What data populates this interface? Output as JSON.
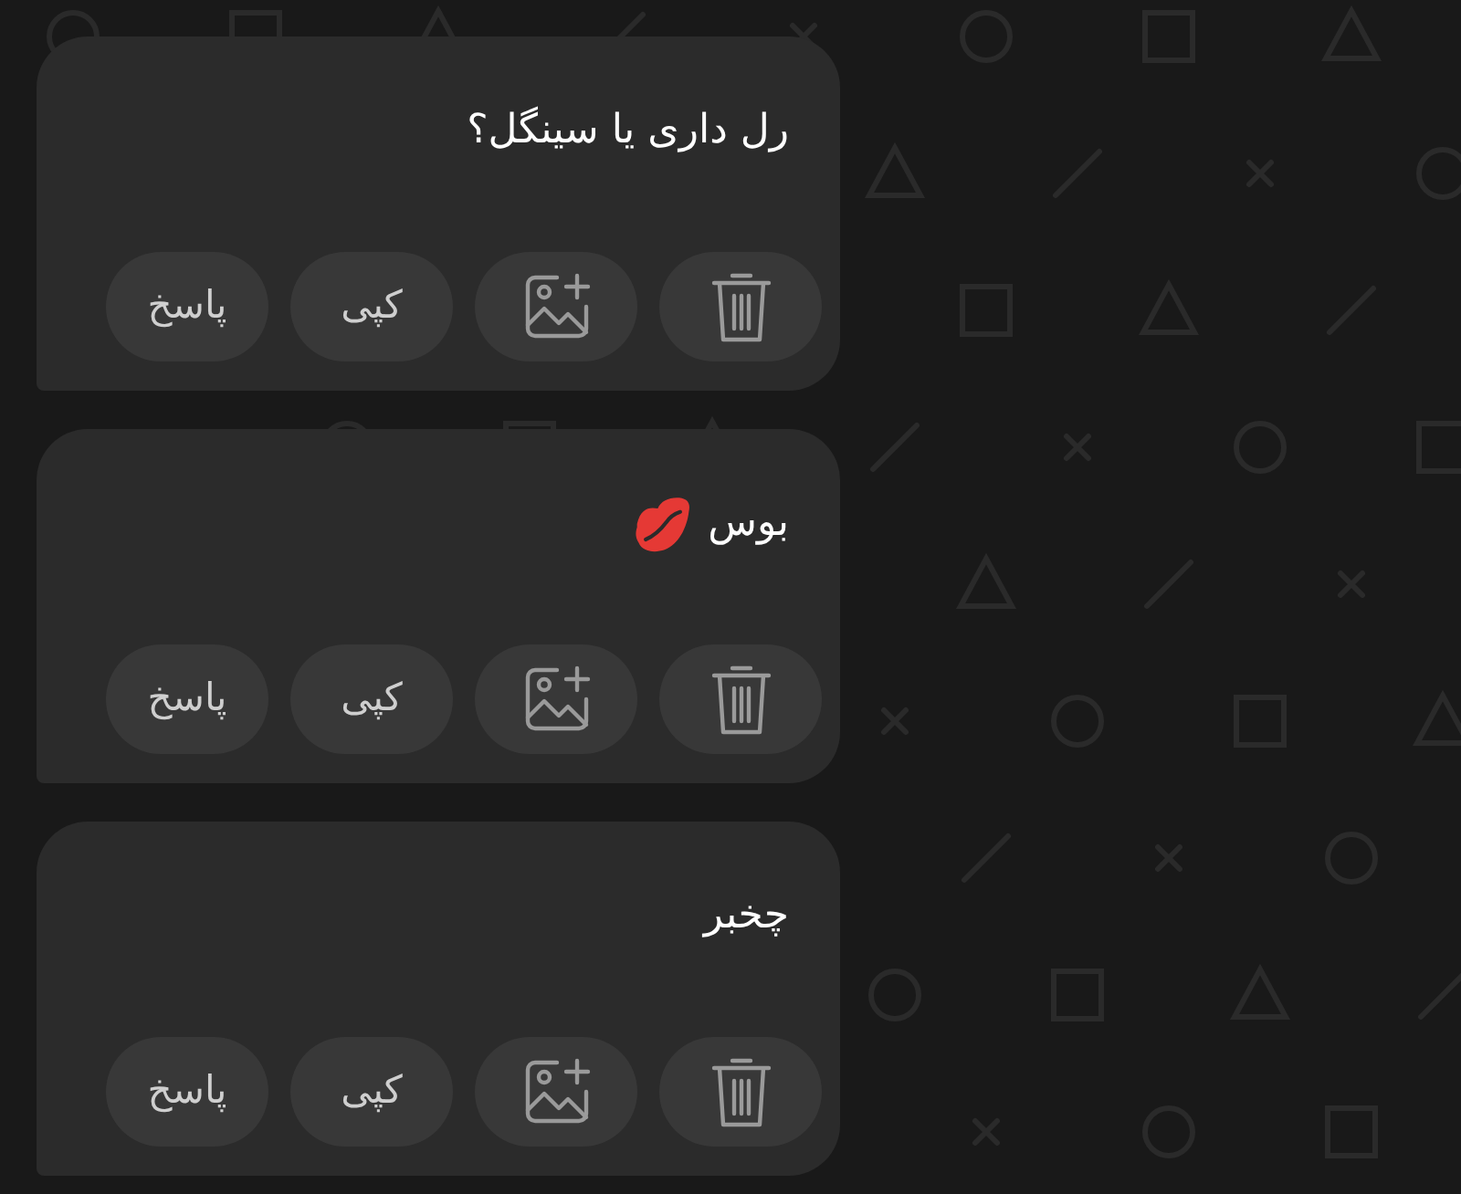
{
  "messages": [
    {
      "text": "رل داری یا سینگل؟",
      "has_emoji": false,
      "actions": [
        {
          "kind": "delete"
        },
        {
          "kind": "add-image"
        },
        {
          "kind": "text",
          "label": "کپی"
        },
        {
          "kind": "text",
          "label": "پاسخ"
        }
      ]
    },
    {
      "text": "بوس",
      "has_emoji": true,
      "actions": [
        {
          "kind": "delete"
        },
        {
          "kind": "add-image"
        },
        {
          "kind": "text",
          "label": "کپی"
        },
        {
          "kind": "text",
          "label": "پاسخ"
        }
      ]
    },
    {
      "text": "چخبر",
      "has_emoji": false,
      "actions": [
        {
          "kind": "delete"
        },
        {
          "kind": "add-image"
        },
        {
          "kind": "text",
          "label": "کپی"
        },
        {
          "kind": "text",
          "label": "پاسخ"
        }
      ]
    }
  ]
}
